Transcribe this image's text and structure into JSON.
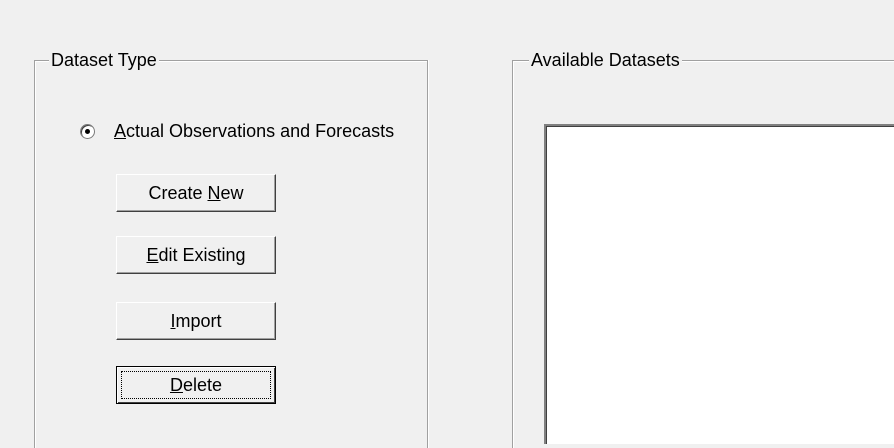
{
  "dataset_type": {
    "legend": "Dataset Type",
    "radio": {
      "label_prefix": "A",
      "label_rest": "ctual Observations and Forecasts",
      "selected": true
    },
    "buttons": {
      "create_new": {
        "prefix": "Create ",
        "mnemonic": "N",
        "rest": "ew"
      },
      "edit_existing": {
        "prefix": "",
        "mnemonic": "E",
        "rest": "dit Existing"
      },
      "import": {
        "prefix": "",
        "mnemonic": "I",
        "rest": "mport"
      },
      "delete": {
        "prefix": "",
        "mnemonic": "D",
        "rest": "elete"
      }
    }
  },
  "available_datasets": {
    "legend": "Available Datasets",
    "items": []
  }
}
